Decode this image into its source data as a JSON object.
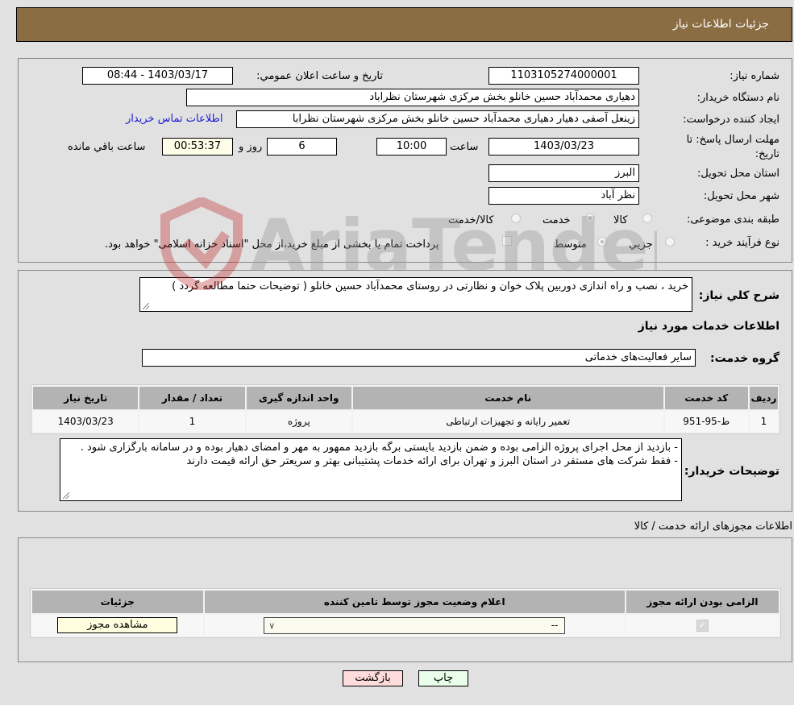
{
  "header": {
    "title": "جزئیات اطلاعات نیاز"
  },
  "details": {
    "need_number_label": "شماره نیاز:",
    "need_number": "1103105274000001",
    "announce_label": "تاريخ و ساعت اعلان عمومي:",
    "announce_value": "1403/03/17 - 08:44",
    "buyer_org_label": "نام دستگاه خریدار:",
    "buyer_org": "دهیاری محمدآباد حسین خانلو بخش مرکزی شهرستان نظراباد",
    "requester_label": "ایجاد کننده درخواست:",
    "requester": "زینعل آصفی دهیار دهیاری محمدآباد حسین خانلو بخش مرکزی شهرستان نظرابا",
    "contact_link": "اطلاعات تماس خریدار",
    "deadline_label": "مهلت ارسال پاسخ: تا تاریخ:",
    "deadline_date": "1403/03/23",
    "hour_label": "ساعت",
    "deadline_time": "10:00",
    "days_value": "6",
    "days_label": "روز و",
    "remaining_time": "00:53:37",
    "remaining_label": "ساعت باقي مانده",
    "province_label": "استان محل تحویل:",
    "province": "البرز",
    "city_label": "شهر محل تحویل:",
    "city": "نظر آباد",
    "category_label": "طبقه بندی موضوعی:",
    "category_options": [
      {
        "label": "کالا",
        "checked": false
      },
      {
        "label": "خدمت",
        "checked": true
      },
      {
        "label": "کالا/خدمت",
        "checked": false
      }
    ],
    "process_label": "نوع فرآیند خرید :",
    "process_options": [
      {
        "label": "جزيي",
        "checked": false
      },
      {
        "label": "متوسط",
        "checked": true
      }
    ],
    "treasury_note": "پرداخت تمام یا بخشی از مبلغ خرید،از محل \"اسناد خزانه اسلامی\" خواهد بود."
  },
  "description": {
    "label": "شرح کلي نياز:",
    "text": "خرید ، نصب و راه اندازی دوربین پلاک خوان و نظارتی در روستای محمدآباد حسین خانلو ( توضیحات حتما مطالعه گردد )"
  },
  "services": {
    "section_title": "اطلاعات خدمات مورد نیاز",
    "group_label": "گروه خدمت:",
    "group_value": "سایر فعالیت‌های خدماتی",
    "columns": [
      "ردیف",
      "کد خدمت",
      "نام خدمت",
      "واحد اندازه گیری",
      "تعداد / مقدار",
      "تاریخ نیاز"
    ],
    "rows": [
      [
        "1",
        "ط-95-951",
        "تعمیر رایانه و تجهیزات ارتباطی",
        "پروژه",
        "1",
        "1403/03/23"
      ]
    ]
  },
  "buyer_notes": {
    "label": "توضیحات خریدار:",
    "lines": [
      "- بازدید از محل اجرای پروژه الزامی بوده و ضمن بازدید بایستی برگه بازدید ممهور به مهر و امضای دهیار بوده و در سامانه بارگزاری شود .",
      "- فقط شرکت های مستقر در استان البرز و تهران برای ارائه خدمات پشتیبانی بهتر و سریعتر حق ارائه قیمت دارند"
    ]
  },
  "permits": {
    "section_title": "اطلاعات مجوزهای ارائه خدمت / کالا",
    "columns": [
      "الزامی بودن ارائه مجوز",
      "اعلام وضعیت مجوز توسط تامین کننده",
      "جزئیات"
    ],
    "row": {
      "required_checked": true,
      "status_value": "--",
      "view_button": "مشاهده مجوز"
    }
  },
  "footer": {
    "print_button": "چاپ",
    "back_button": "بازگشت"
  },
  "watermark": {
    "text": "AriaTender.neT"
  },
  "colors": {
    "header_bg": "#8b6d44",
    "print_bg": "#eaffea",
    "back_bg": "#ffdcdc"
  }
}
